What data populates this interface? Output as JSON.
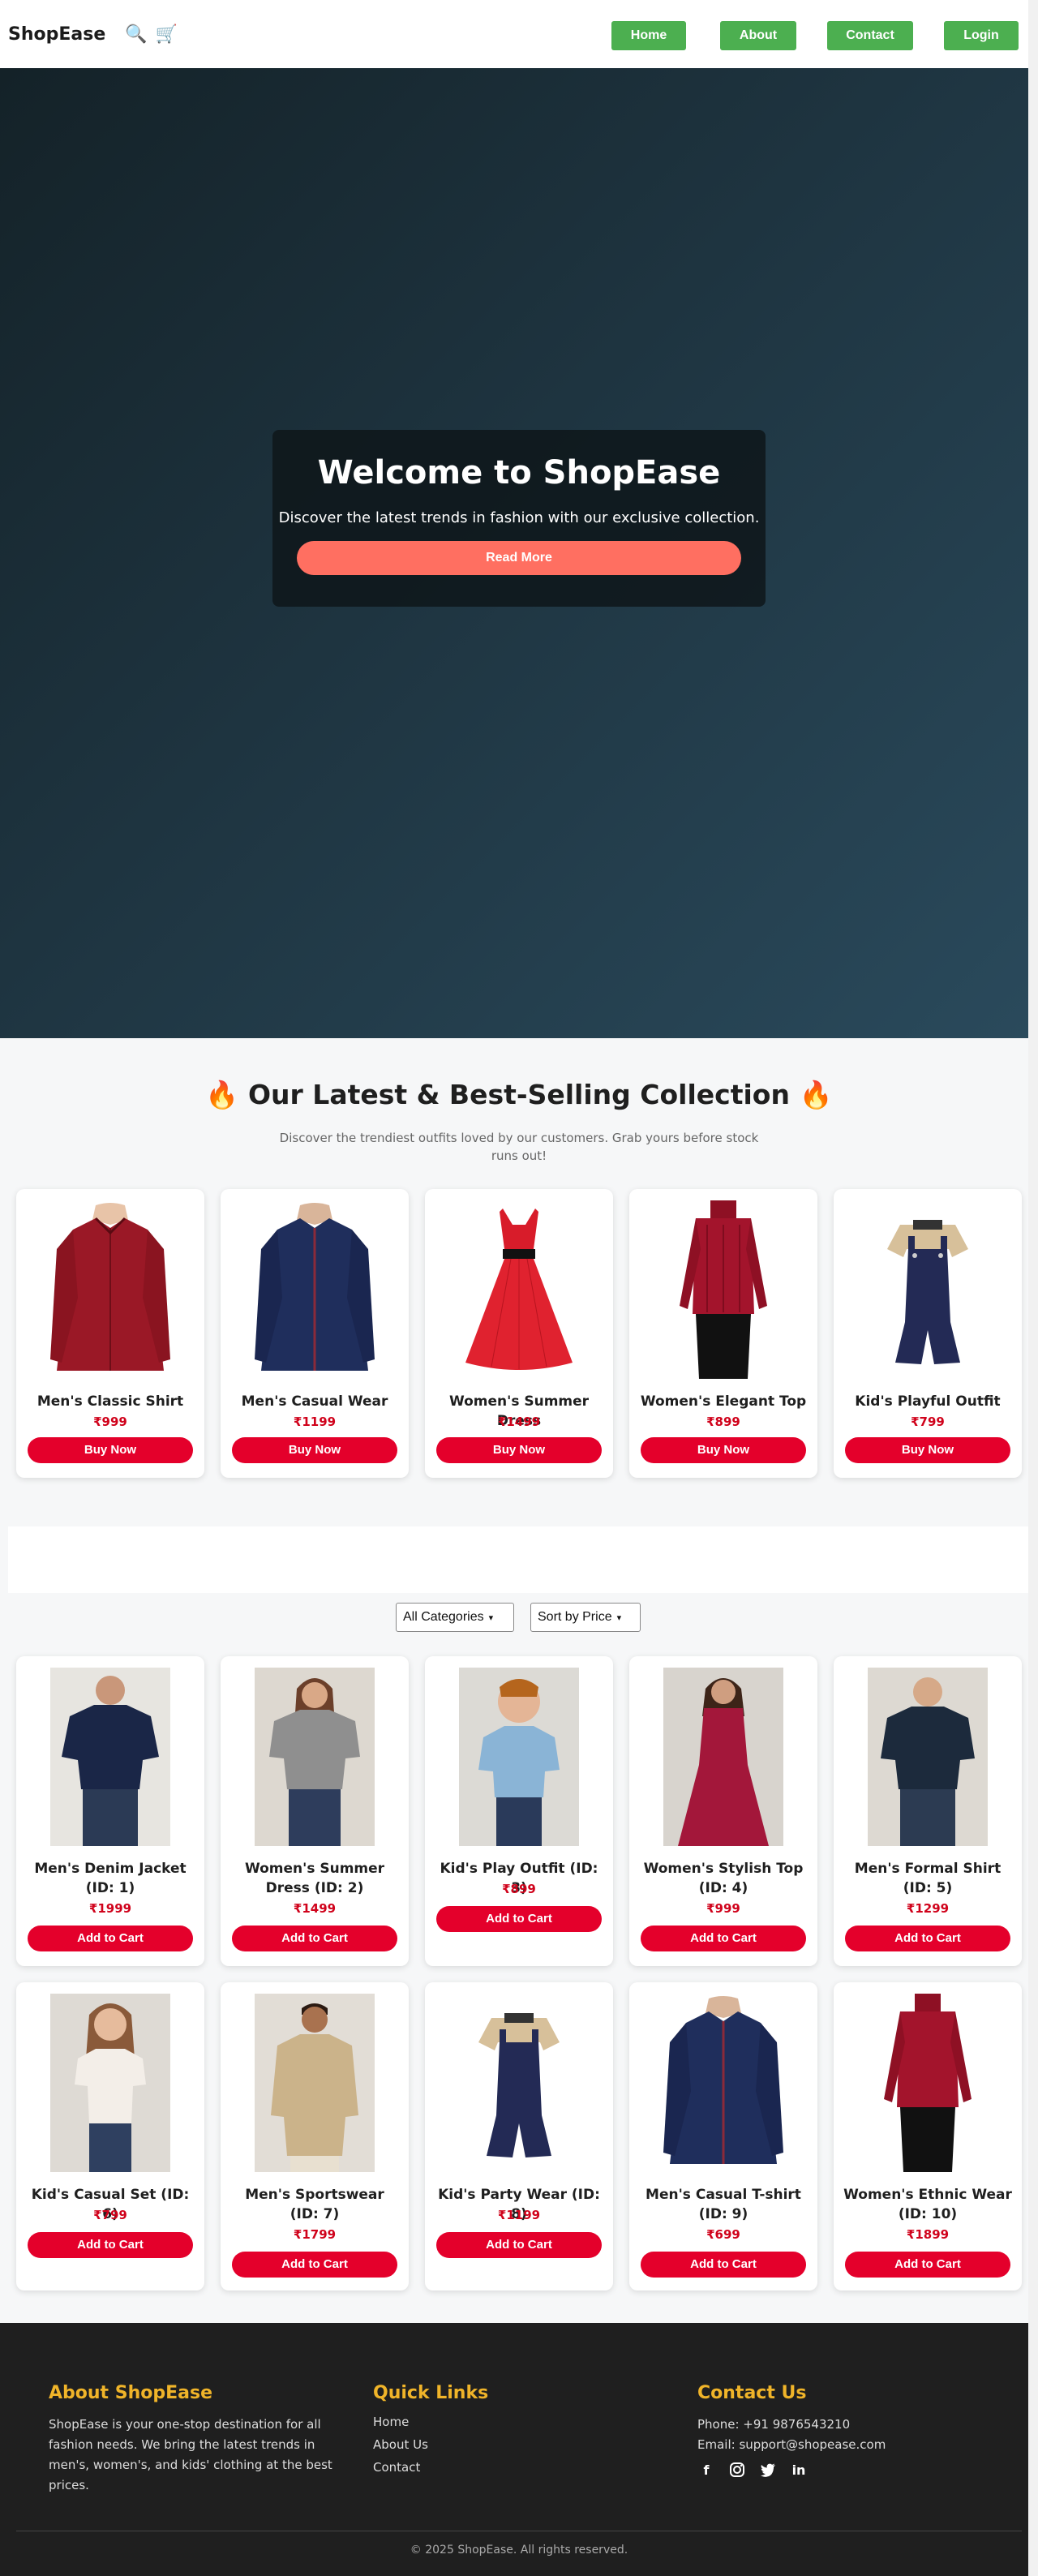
{
  "brand": "ShopEase",
  "nav": {
    "home": "Home",
    "about": "About",
    "contact": "Contact",
    "login": "Login",
    "icons": [
      "search-icon",
      "cart-icon"
    ]
  },
  "hero": {
    "title": "Welcome to ShopEase",
    "subtitle": "Discover the latest trends in fashion with our exclusive collection.",
    "button": "Read More"
  },
  "featured": {
    "title": "🔥 Our Latest & Best-Selling Collection 🔥",
    "subtitle": "Discover the trendiest outfits loved by our customers. Grab yours before stock runs out!",
    "items": [
      {
        "name": "Men's Classic Shirt",
        "price": "₹999",
        "button": "Buy Now"
      },
      {
        "name": "Men's Casual Wear",
        "price": "₹1199",
        "button": "Buy Now"
      },
      {
        "name": "Women's Summer Dress",
        "price": "₹1499",
        "button": "Buy Now"
      },
      {
        "name": "Women's Elegant Top",
        "price": "₹899",
        "button": "Buy Now"
      },
      {
        "name": "Kid's Playful Outfit",
        "price": "₹799",
        "button": "Buy Now"
      }
    ]
  },
  "filters": {
    "category": "All Categories",
    "sort": "Sort by Price"
  },
  "products": [
    {
      "name": "Men's Denim Jacket (ID: 1)",
      "price": "₹1999",
      "button": "Add to Cart"
    },
    {
      "name": "Women's Summer Dress (ID: 2)",
      "price": "₹1499",
      "button": "Add to Cart"
    },
    {
      "name": "Kid's Play Outfit (ID: 3)",
      "price": "₹899",
      "button": "Add to Cart"
    },
    {
      "name": "Women's Stylish Top (ID: 4)",
      "price": "₹999",
      "button": "Add to Cart"
    },
    {
      "name": "Men's Formal Shirt (ID: 5)",
      "price": "₹1299",
      "button": "Add to Cart"
    },
    {
      "name": "Kid's Casual Set (ID: 6)",
      "price": "₹799",
      "button": "Add to Cart"
    },
    {
      "name": "Men's Sportswear (ID: 7)",
      "price": "₹1799",
      "button": "Add to Cart"
    },
    {
      "name": "Kid's Party Wear (ID: 8)",
      "price": "₹1199",
      "button": "Add to Cart"
    },
    {
      "name": "Men's Casual T-shirt (ID: 9)",
      "price": "₹699",
      "button": "Add to Cart"
    },
    {
      "name": "Women's Ethnic Wear (ID: 10)",
      "price": "₹1899",
      "button": "Add to Cart"
    }
  ],
  "footer": {
    "about_title": "About ShopEase",
    "about_text": "ShopEase is your one-stop destination for all fashion needs. We bring the latest trends in men's, women's, and kids' clothing at the best prices.",
    "links_title": "Quick Links",
    "links": [
      "Home",
      "About Us",
      "Contact"
    ],
    "contact_title": "Contact Us",
    "phone": "Phone: +91 9876543210",
    "email": "Email: support@shopease.com",
    "socials": [
      "facebook-icon",
      "instagram-icon",
      "twitter-icon",
      "linkedin-icon"
    ],
    "copyright": "© 2025 ShopEase. All rights reserved."
  },
  "colors": {
    "nav_button": "#4caf50",
    "hero_button": "#ff6f61",
    "cta": "#e4002b",
    "price": "#d0021b",
    "footer_heading": "#f0b429",
    "footer_bg": "#1f1f1f"
  }
}
